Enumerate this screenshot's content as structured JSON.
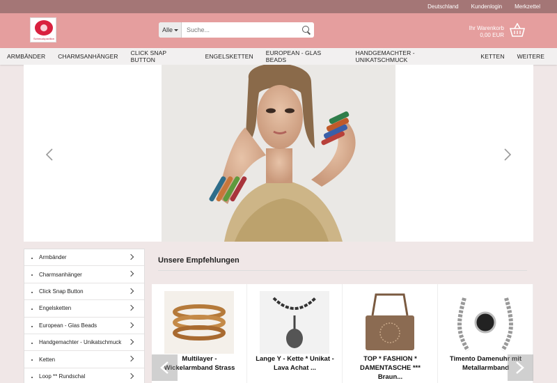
{
  "topbar": {
    "links": [
      "Deutschland",
      "Kundenlogin",
      "Merkzettel"
    ]
  },
  "header": {
    "logo_text": "Schmuckpavillon",
    "search": {
      "category": "Alle",
      "placeholder": "Suche..."
    },
    "cart": {
      "label": "Ihr Warenkorb",
      "amount": "0,00 EUR"
    }
  },
  "nav": {
    "items": [
      "ARMBÄNDER",
      "CHARMSANHÄNGER",
      "CLICK SNAP BUTTON",
      "ENGELSKETTEN",
      "EUROPEAN - GLAS BEADS",
      "HANDGEMACHTER - UNIKATSCHMUCK",
      "KETTEN",
      "WEITERE"
    ]
  },
  "sidebar": {
    "items": [
      "Armbänder",
      "Charmsanhänger",
      "Click Snap Button",
      "Engelsketten",
      "European - Glas Beads",
      "Handgemachter - Unikatschmuck",
      "Ketten",
      "Loop ** Rundschal"
    ]
  },
  "recommendations": {
    "title": "Unsere Empfehlungen",
    "products": [
      {
        "name": "Multilayer - Wickelarmband Strass"
      },
      {
        "name": "Lange Y - Kette * Unikat - Lava Achat ..."
      },
      {
        "name": "TOP * FASHION * DAMENTASCHE *** Braun..."
      },
      {
        "name": "Timento Damenuhr mit Metallarmband"
      }
    ]
  },
  "colors": {
    "topbar": "#a47676",
    "header": "#e59e9e",
    "background": "#f0e7e7"
  }
}
